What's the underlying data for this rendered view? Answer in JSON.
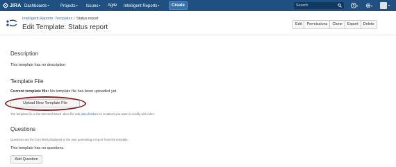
{
  "topbar": {
    "logo_text": "JIRA",
    "nav": [
      {
        "label": "Dashboards",
        "has_caret": true
      },
      {
        "label": "Projects",
        "has_caret": true
      },
      {
        "label": "Issues",
        "has_caret": true
      },
      {
        "label": "Agile",
        "has_caret": false
      },
      {
        "label": "Intelligent Reports",
        "has_caret": true
      }
    ],
    "create_label": "Create",
    "search_placeholder": "Search",
    "colors": {
      "bar": "#205081",
      "create": "#3572b0",
      "search": "#113a63"
    },
    "icons": [
      "help-icon",
      "gear-icon",
      "avatar"
    ]
  },
  "header": {
    "breadcrumb_link": "Intelligent Reports: Templates",
    "breadcrumb_separator": "/",
    "breadcrumb_current": "Status report",
    "title": "Edit Template: Status report",
    "actions": [
      "Edit",
      "Permissions",
      "Clone",
      "Export",
      "Delete"
    ]
  },
  "description": {
    "heading": "Description",
    "text": "This template has no description"
  },
  "template_file": {
    "heading": "Template File",
    "current_label": "Current template file:",
    "current_value": "No template file has been uploaded yet.",
    "upload_button": "Upload New Template File",
    "help_prefix": "The template file is the Microsoft Word .docx file with",
    "help_link": "placeholders",
    "help_suffix": "for locations you want to modify with rules."
  },
  "questions": {
    "heading": "Questions",
    "help": "Questions are the form fields displayed to the user generating a report from this template.",
    "empty_text": "This template has no questions.",
    "add_button": "Add Question"
  }
}
